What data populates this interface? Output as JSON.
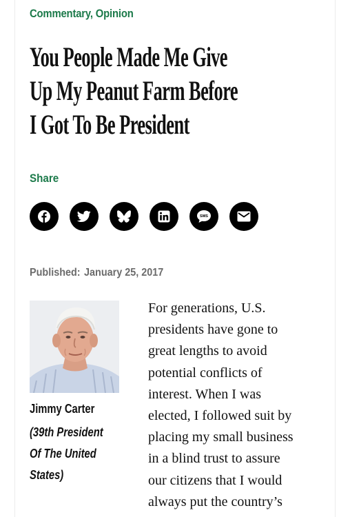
{
  "article": {
    "categories": [
      "Commentary",
      "Opinion"
    ],
    "category_separator": ", ",
    "headline_lines": [
      "You People Made Me Give",
      "Up My Peanut Farm Before",
      "I Got To Be President"
    ],
    "share_label": "Share",
    "share_buttons": [
      {
        "name": "facebook",
        "icon": "facebook-icon"
      },
      {
        "name": "twitter",
        "icon": "twitter-icon"
      },
      {
        "name": "bluesky",
        "icon": "bluesky-icon"
      },
      {
        "name": "linkedin",
        "icon": "linkedin-icon"
      },
      {
        "name": "sms",
        "icon": "sms-icon",
        "glyph": "SMS"
      },
      {
        "name": "email",
        "icon": "email-icon"
      }
    ],
    "published_label": "Published:",
    "published_date": "January 25, 2017",
    "author": {
      "name": "Jimmy Carter",
      "title_lines": [
        "(39th President",
        "Of The United",
        "States)"
      ]
    },
    "body_lines": [
      "For generations, U.S.",
      "presidents have gone to",
      "great lengths to avoid",
      "potential conflicts of",
      "interest. When I was",
      "elected, I followed suit by",
      "placing my small business",
      "in a blind trust to assure",
      "our citizens that I would",
      "always put the country’s"
    ]
  },
  "colors": {
    "accent_green": "#1c7a4a",
    "share_button": "#000000",
    "published_gray": "#6b6b6b"
  }
}
